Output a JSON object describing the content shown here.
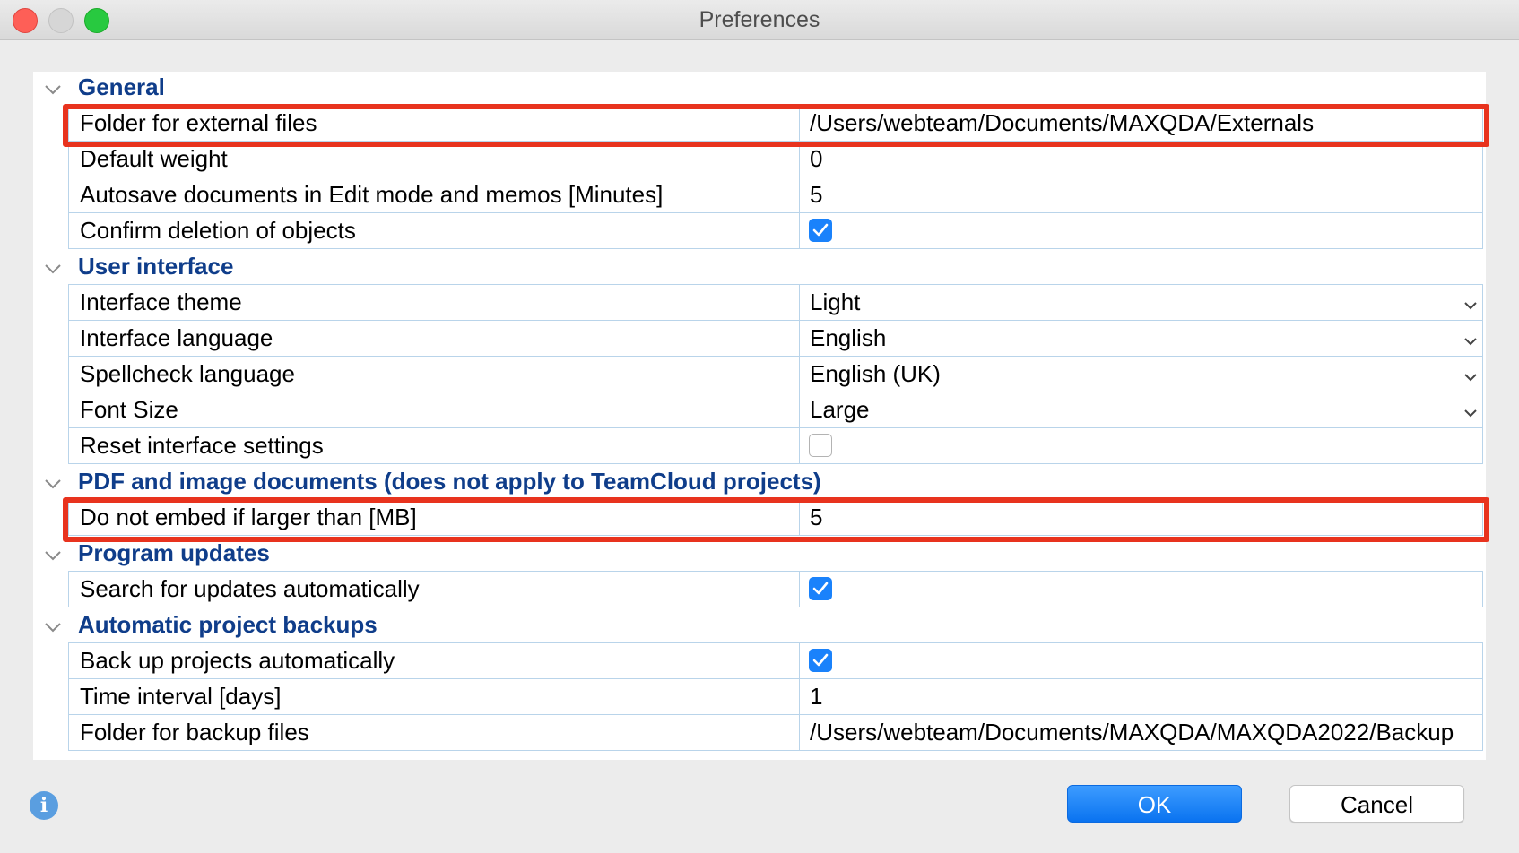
{
  "window": {
    "title": "Preferences"
  },
  "sections": {
    "general": {
      "title": "General",
      "rows": {
        "external_folder": {
          "label": "Folder for external files",
          "value": "/Users/webteam/Documents/MAXQDA/Externals"
        },
        "default_weight": {
          "label": "Default weight",
          "value": "0"
        },
        "autosave": {
          "label": "Autosave documents in Edit mode and memos [Minutes]",
          "value": "5"
        },
        "confirm_deletion": {
          "label": "Confirm deletion of objects",
          "checked": true
        }
      }
    },
    "user_interface": {
      "title": "User interface",
      "rows": {
        "theme": {
          "label": "Interface theme",
          "value": "Light"
        },
        "language": {
          "label": "Interface language",
          "value": "English"
        },
        "spellcheck": {
          "label": "Spellcheck language",
          "value": "English (UK)"
        },
        "font_size": {
          "label": "Font Size",
          "value": "Large"
        },
        "reset": {
          "label": "Reset interface settings",
          "checked": false
        }
      }
    },
    "pdf": {
      "title": "PDF and image documents (does not apply to TeamCloud projects)",
      "rows": {
        "embed_limit": {
          "label": "Do not embed if larger than [MB]",
          "value": "5"
        }
      }
    },
    "updates": {
      "title": "Program updates",
      "rows": {
        "search_updates": {
          "label": "Search for updates automatically",
          "checked": true
        }
      }
    },
    "backups": {
      "title": "Automatic project backups",
      "rows": {
        "backup_auto": {
          "label": "Back up projects automatically",
          "checked": true
        },
        "interval": {
          "label": "Time interval [days]",
          "value": "1"
        },
        "backup_folder": {
          "label": "Folder for backup files",
          "value": "/Users/webteam/Documents/MAXQDA/MAXQDA2022/Backup"
        }
      }
    }
  },
  "buttons": {
    "ok": "OK",
    "cancel": "Cancel",
    "info_glyph": "i"
  },
  "colors": {
    "section_title": "#0f3d8a",
    "highlight": "#e8331e",
    "checkbox_on": "#1a82fb",
    "row_border": "#b9d4ea"
  }
}
